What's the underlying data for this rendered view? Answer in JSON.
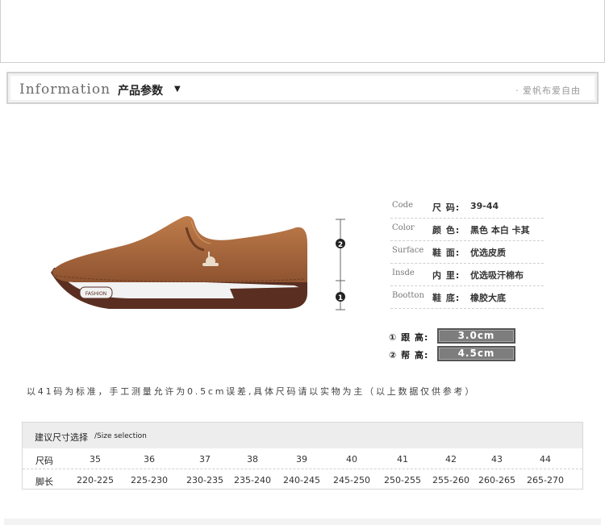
{
  "header": {
    "title_en": "Information",
    "title_cn": "产品参数",
    "arrow": "▼",
    "slogan": "· 爱帆布爱自由"
  },
  "specs": [
    {
      "en": "Code",
      "key": "尺 码:",
      "value": "39-44"
    },
    {
      "en": "Color",
      "key": "颜 色:",
      "value": "黑色 本白 卡其"
    },
    {
      "en": "Surface",
      "key": "鞋 面:",
      "value": "优选皮质"
    },
    {
      "en": "Insde",
      "key": "内 里:",
      "value": "优选吸汗棉布"
    },
    {
      "en": "Bootton",
      "key": "鞋 底:",
      "value": "橡胶大底"
    }
  ],
  "heights": [
    {
      "label": "① 跟 高:",
      "value": "3.0cm"
    },
    {
      "label": "② 帮 高:",
      "value": "4.5cm"
    }
  ],
  "measure_markers": [
    "2",
    "1"
  ],
  "shoe": {
    "tag_text": "FASHION",
    "upper_color": "#a8673a",
    "sole_color": "#5a2f22"
  },
  "note": "以41码为标准，手工测量允许为0.5cm误差,具体尺码请以实物为主（以上数据仅供参考）",
  "size_table": {
    "title_cn": "建议尺寸选择",
    "title_en": "/Size selection",
    "row1_label": "尺码",
    "row2_label": "脚长",
    "sizes": [
      "35",
      "36",
      "37",
      "38",
      "39",
      "40",
      "41",
      "42",
      "43",
      "44"
    ],
    "lengths": [
      "220-225",
      "225-230",
      "230-235",
      "235-240",
      "240-245",
      "245-250",
      "250-255",
      "255-260",
      "260-265",
      "265-270"
    ]
  }
}
